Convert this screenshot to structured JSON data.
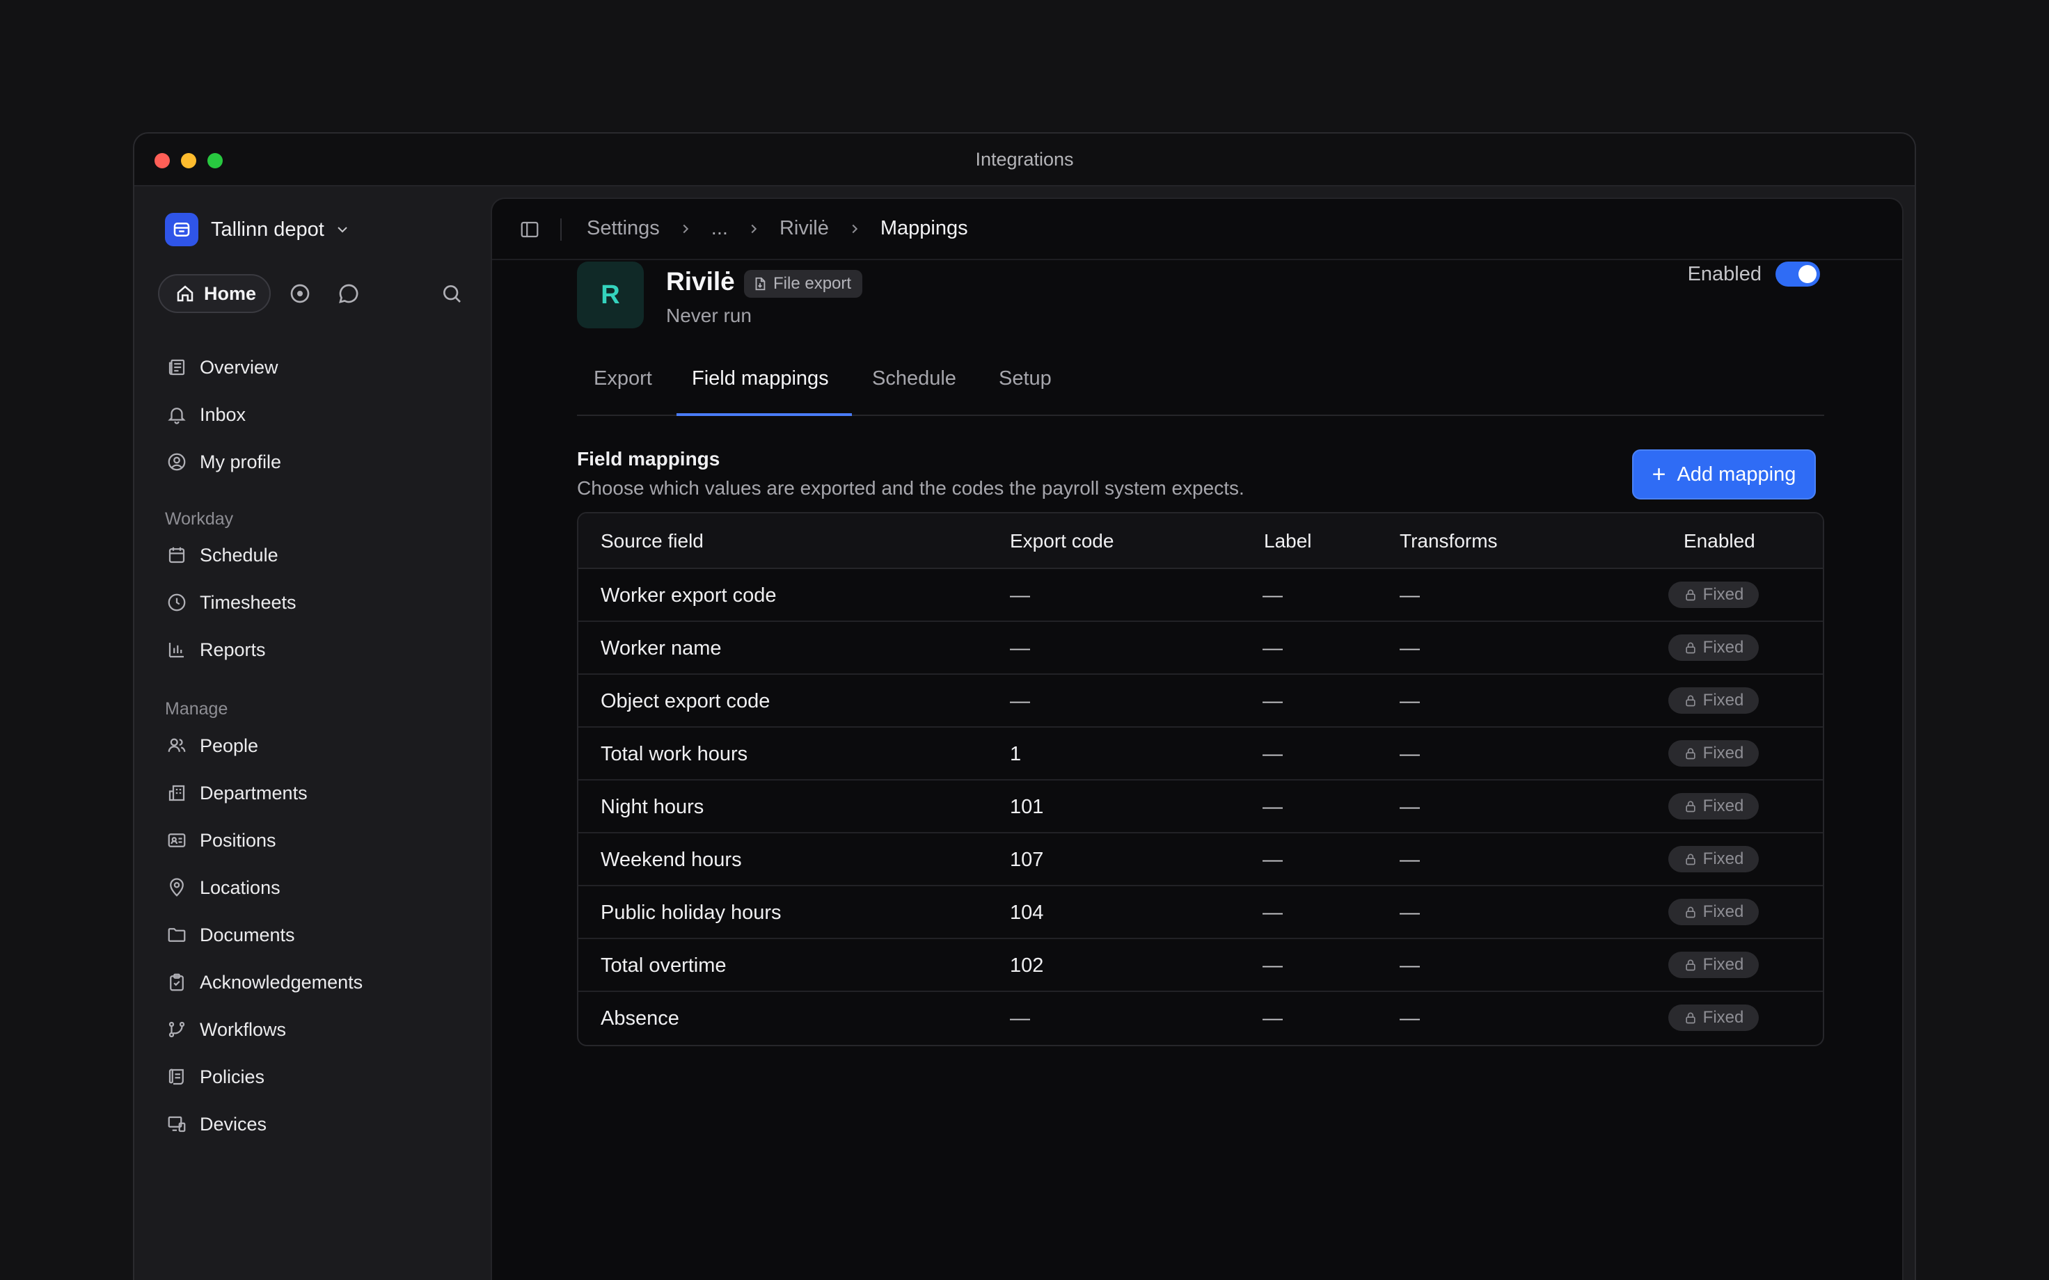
{
  "window": {
    "title": "Integrations"
  },
  "sidebar": {
    "workspace": "Tallinn depot",
    "home_label": "Home",
    "top_items": [
      {
        "label": "Overview",
        "icon": "overview-icon"
      },
      {
        "label": "Inbox",
        "icon": "bell-icon"
      },
      {
        "label": "My profile",
        "icon": "user-circle-icon"
      }
    ],
    "sections": [
      {
        "title": "Workday",
        "items": [
          {
            "label": "Schedule",
            "icon": "calendar-icon"
          },
          {
            "label": "Timesheets",
            "icon": "clock-icon"
          },
          {
            "label": "Reports",
            "icon": "bar-chart-icon"
          }
        ]
      },
      {
        "title": "Manage",
        "items": [
          {
            "label": "People",
            "icon": "people-icon"
          },
          {
            "label": "Departments",
            "icon": "building-icon"
          },
          {
            "label": "Positions",
            "icon": "id-card-icon"
          },
          {
            "label": "Locations",
            "icon": "map-pin-icon"
          },
          {
            "label": "Documents",
            "icon": "folder-icon"
          },
          {
            "label": "Acknowledgements",
            "icon": "clipboard-check-icon"
          },
          {
            "label": "Workflows",
            "icon": "git-branch-icon"
          },
          {
            "label": "Policies",
            "icon": "scroll-icon"
          },
          {
            "label": "Devices",
            "icon": "devices-icon"
          }
        ]
      }
    ]
  },
  "breadcrumb": [
    "Settings",
    "...",
    "Rivilė",
    "Mappings"
  ],
  "app": {
    "logo_letter": "R",
    "name": "Rivilė",
    "badge": "File export",
    "status": "Never run",
    "enabled_label": "Enabled",
    "enabled": true
  },
  "tabs": [
    "Export",
    "Field mappings",
    "Schedule",
    "Setup"
  ],
  "active_tab": "Field mappings",
  "section": {
    "title": "Field mappings",
    "description": "Choose which values are exported and the codes the payroll system expects.",
    "add_button": "Add mapping"
  },
  "table": {
    "columns": [
      "Source field",
      "Export code",
      "Label",
      "Transforms",
      "Enabled"
    ],
    "rows": [
      {
        "source": "Worker export code",
        "code": "—",
        "label": "—",
        "transforms": "—",
        "enabled": "Fixed"
      },
      {
        "source": "Worker name",
        "code": "—",
        "label": "—",
        "transforms": "—",
        "enabled": "Fixed"
      },
      {
        "source": "Object export code",
        "code": "—",
        "label": "—",
        "transforms": "—",
        "enabled": "Fixed"
      },
      {
        "source": "Total work hours",
        "code": "1",
        "label": "—",
        "transforms": "—",
        "enabled": "Fixed"
      },
      {
        "source": "Night hours",
        "code": "101",
        "label": "—",
        "transforms": "—",
        "enabled": "Fixed"
      },
      {
        "source": "Weekend hours",
        "code": "107",
        "label": "—",
        "transforms": "—",
        "enabled": "Fixed"
      },
      {
        "source": "Public holiday hours",
        "code": "104",
        "label": "—",
        "transforms": "—",
        "enabled": "Fixed"
      },
      {
        "source": "Total overtime",
        "code": "102",
        "label": "—",
        "transforms": "—",
        "enabled": "Fixed"
      },
      {
        "source": "Absence",
        "code": "—",
        "label": "—",
        "transforms": "—",
        "enabled": "Fixed"
      }
    ]
  },
  "colors": {
    "accent": "#2f6cf5",
    "logo_teal": "#34d3bd"
  }
}
